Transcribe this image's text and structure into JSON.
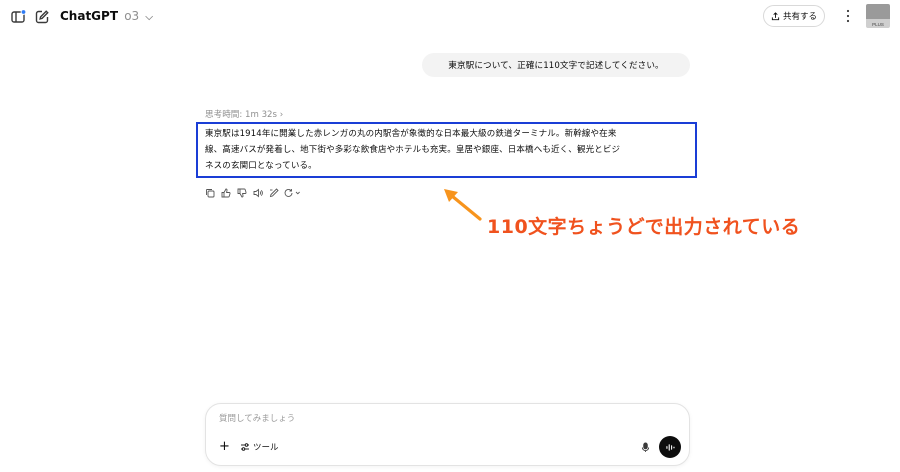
{
  "header": {
    "model_name": "ChatGPT",
    "model_version": "o3",
    "share_label": "共有する",
    "avatar_text": "PLUS"
  },
  "conversation": {
    "user_message": "東京駅について、正確に110文字で記述してください。",
    "thinking_label": "思考時間: 1m 32s",
    "answer_lines": [
      "東京駅は1914年に開業した赤レンガの丸の内駅舎が象徴的な日本最大級の鉄道ターミナル。新幹線や在来",
      "線、高速バスが発着し、地下街や多彩な飲食店やホテルも充実。皇居や銀座、日本橋へも近く、観光とビジ",
      "ネスの玄関口となっている。"
    ]
  },
  "annotation": {
    "text": "110文字ちょうどで出力されている",
    "text_color": "#f0521e",
    "box_color": "#1a3ed6"
  },
  "composer": {
    "placeholder": "質問してみましょう",
    "tools_label": "ツール"
  },
  "icons": {
    "sidebar": "sidebar-icon",
    "new_chat": "new-chat-icon",
    "share": "share-icon",
    "more": "more-vertical-icon",
    "copy": "copy-icon",
    "thumbs_up": "thumbs-up-icon",
    "thumbs_down": "thumbs-down-icon",
    "read_aloud": "speaker-icon",
    "edit": "edit-canvas-icon",
    "regenerate": "regenerate-icon",
    "plus": "plus-icon",
    "tools": "tools-icon",
    "mic": "mic-icon",
    "voice": "voice-mode-icon"
  }
}
